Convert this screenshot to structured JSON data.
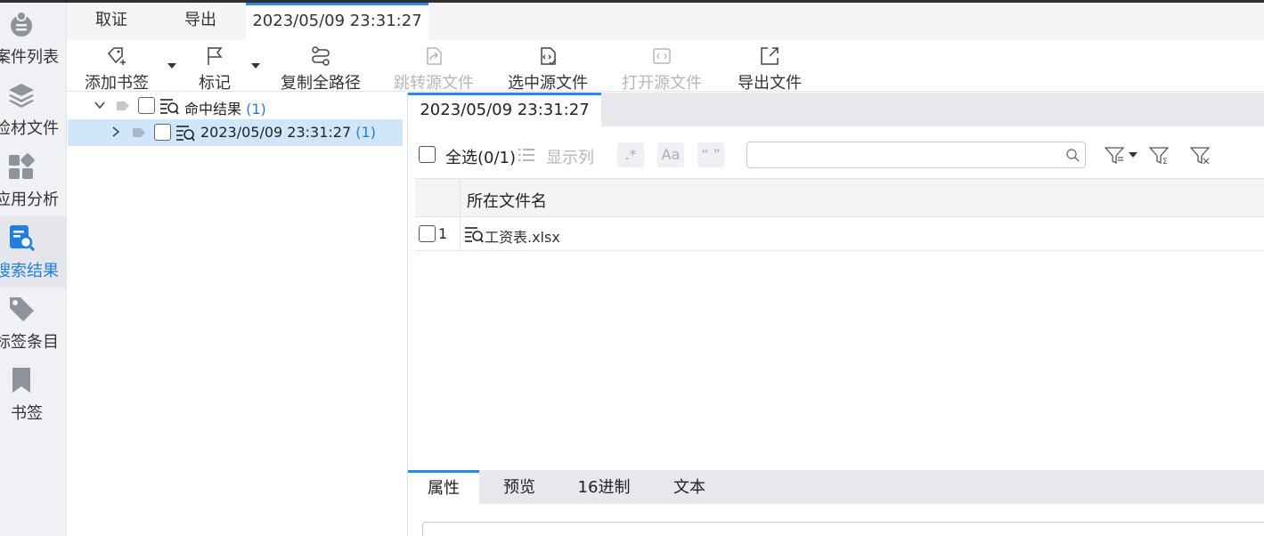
{
  "nav": {
    "items": [
      {
        "label": "案件列表",
        "icon": "case-list-icon"
      },
      {
        "label": "检材文件",
        "icon": "layers-icon"
      },
      {
        "label": "应用分析",
        "icon": "apps-grid-icon"
      },
      {
        "label": "搜索结果",
        "icon": "search-result-icon",
        "active": true
      },
      {
        "label": "标签条目",
        "icon": "tag-icon"
      },
      {
        "label": "书签",
        "icon": "bookmark-icon"
      }
    ]
  },
  "top_tabs": [
    "取证",
    "导出",
    "2023/05/09 23:31:27"
  ],
  "toolbar": {
    "add_bookmark": "添加书签",
    "mark": "标记",
    "copy_full_path": "复制全路径",
    "jump_source": "跳转源文件",
    "select_source": "选中源文件",
    "open_source": "打开源文件",
    "export_file": "导出文件"
  },
  "tree": {
    "root_label": "命中结果",
    "root_count": "(1)",
    "child_label": "2023/05/09 23:31:27",
    "child_count": "(1)"
  },
  "main": {
    "tab": "2023/05/09 23:31:27",
    "select_all": "全选(0/1)",
    "show_columns": "显示列",
    "regex_btn": ".*",
    "case_btn": "Aa",
    "quote_btn": "“ ”",
    "search_placeholder": "",
    "column_header": "所在文件名",
    "rows": [
      {
        "index": "1",
        "file": "工资表.xlsx"
      }
    ]
  },
  "bottom_tabs": [
    "属性",
    "预览",
    "16进制",
    "文本"
  ],
  "colors": {
    "accent": "#2b8ae6",
    "selected_row": "#cfe6fb",
    "nav_bg": "#f0f1f4"
  }
}
